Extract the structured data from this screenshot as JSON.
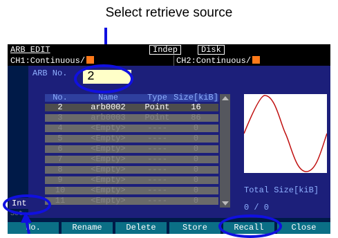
{
  "annotations": {
    "caption": "Select retrieve source"
  },
  "top_bar": {
    "title": "ARB EDIT",
    "mode": "Indep",
    "storage": "Disk"
  },
  "channels": {
    "ch1": "CH1:Continuous/",
    "ch2": "CH2:Continuous/"
  },
  "arb": {
    "label": "ARB No.",
    "value": "2"
  },
  "table": {
    "headers": [
      "No.",
      "Name",
      "Type",
      "Size[kiB]"
    ],
    "rows": [
      {
        "no": "2",
        "name": "arb0002",
        "type": "Point",
        "size": "16"
      },
      {
        "no": "3",
        "name": "arb0003",
        "type": "Point",
        "size": "86"
      },
      {
        "no": "4",
        "name": "<Empty>",
        "type": "----",
        "size": "0"
      },
      {
        "no": "5",
        "name": "<Empty>",
        "type": "----",
        "size": "0"
      },
      {
        "no": "6",
        "name": "<Empty>",
        "type": "----",
        "size": "0"
      },
      {
        "no": "7",
        "name": "<Empty>",
        "type": "----",
        "size": "0"
      },
      {
        "no": "8",
        "name": "<Empty>",
        "type": "----",
        "size": "0"
      },
      {
        "no": "9",
        "name": "<Empty>",
        "type": "----",
        "size": "0"
      },
      {
        "no": "10",
        "name": "<Empty>",
        "type": "----",
        "size": "0"
      },
      {
        "no": "11",
        "name": "<Empty>",
        "type": "----",
        "size": "0"
      }
    ]
  },
  "preview": {
    "total_label": "Total Size[kiB]",
    "total_value": "0 / 0"
  },
  "source": {
    "value": "Int"
  },
  "softkeys": [
    "No.",
    "Rename",
    "Delete",
    "Store",
    "Recall",
    "Close"
  ],
  "colors": {
    "accent": "#ff7a1a",
    "annotation": "#1010e0",
    "waveform": "#c01010"
  }
}
